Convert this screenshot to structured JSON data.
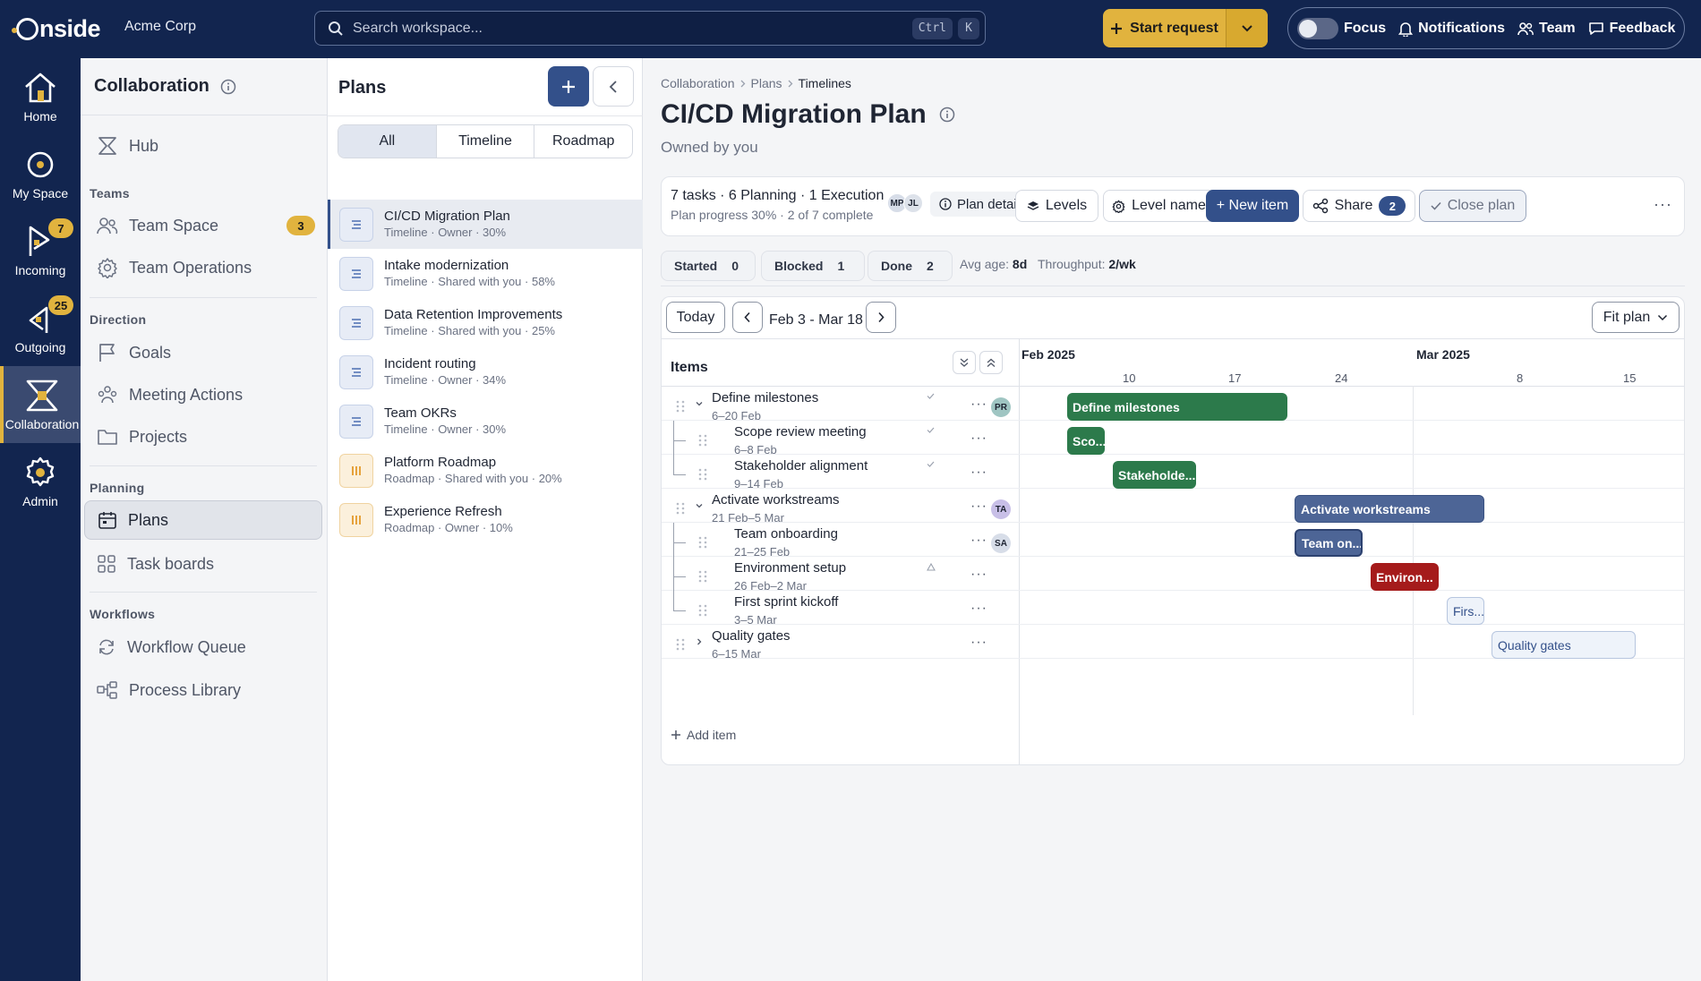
{
  "app": {
    "org_name": "Acme Corp",
    "logo_text": "nside",
    "search_placeholder": "Search workspace...",
    "search_keys": [
      "Ctrl",
      "K"
    ],
    "start_request": "Start request",
    "focus_label": "Focus",
    "focus_on": false,
    "notifications_label": "Notifications",
    "team_label": "Team",
    "feedback_label": "Feedback"
  },
  "rail": [
    {
      "label": "Home",
      "icon": "home-icon"
    },
    {
      "label": "My Space",
      "icon": "target-icon"
    },
    {
      "label": "Incoming",
      "icon": "incoming-flag-icon",
      "badge": "7"
    },
    {
      "label": "Outgoing",
      "icon": "outgoing-flag-icon",
      "badge": "25"
    },
    {
      "label": "Collaboration",
      "icon": "hourglass-icon",
      "active": true
    },
    {
      "label": "Admin",
      "icon": "gear-icon"
    }
  ],
  "nav": {
    "title": "Collaboration",
    "hub": "Hub",
    "sections": {
      "teams": "Teams",
      "direction": "Direction",
      "planning": "Planning",
      "workflows": "Workflows"
    },
    "items": {
      "team_space": "Team Space",
      "team_space_badge": "3",
      "team_operations": "Team Operations",
      "goals": "Goals",
      "meeting_actions": "Meeting Actions",
      "projects": "Projects",
      "plans": "Plans",
      "task_boards": "Task boards",
      "workflow_queue": "Workflow Queue",
      "process_library": "Process Library"
    }
  },
  "plans_panel": {
    "title": "Plans",
    "tabs": [
      "All",
      "Timeline",
      "Roadmap"
    ],
    "active_tab": "All",
    "list": [
      {
        "name": "CI/CD Migration Plan",
        "meta": "Timeline · Owner · 30%",
        "kind": "timeline",
        "selected": true
      },
      {
        "name": "Intake modernization",
        "meta": "Timeline · Shared with you · 58%",
        "kind": "timeline"
      },
      {
        "name": "Data Retention Improvements",
        "meta": "Timeline · Shared with you · 25%",
        "kind": "timeline"
      },
      {
        "name": "Incident routing",
        "meta": "Timeline · Owner · 34%",
        "kind": "timeline"
      },
      {
        "name": "Team OKRs",
        "meta": "Timeline · Owner · 30%",
        "kind": "timeline"
      },
      {
        "name": "Platform Roadmap",
        "meta": "Roadmap · Shared with you · 20%",
        "kind": "roadmap"
      },
      {
        "name": "Experience Refresh",
        "meta": "Roadmap · Owner · 10%",
        "kind": "roadmap"
      }
    ]
  },
  "main": {
    "breadcrumb": [
      "Collaboration",
      "Plans",
      "Timelines"
    ],
    "title": "CI/CD Migration Plan",
    "subtitle": "Owned by you",
    "summary": "7 tasks · 6 Planning · 1 Execution",
    "progress": "Plan progress 30% · 2 of 7 complete",
    "members": [
      "MP",
      "JL"
    ],
    "plan_details": "Plan details",
    "levels": "Levels",
    "level_names": "Level names",
    "new_item": "+ New item",
    "share": "Share",
    "share_count": "2",
    "close_plan": "Close plan",
    "chips": [
      {
        "label": "Started",
        "value": "0"
      },
      {
        "label": "Blocked",
        "value": "1"
      },
      {
        "label": "Done",
        "value": "2"
      }
    ],
    "avg_age_label": "Avg age:",
    "avg_age": "8d",
    "throughput_label": "Throughput:",
    "throughput": "2/wk"
  },
  "gantt": {
    "today": "Today",
    "range": "Feb 3 - Mar 18",
    "fit": "Fit plan",
    "items_header": "Items",
    "months": [
      {
        "label": "Feb 2025",
        "day": 0
      },
      {
        "label": "Mar 2025",
        "day": 26
      }
    ],
    "ticks": [
      {
        "label": "10",
        "day": 7
      },
      {
        "label": "17",
        "day": 14
      },
      {
        "label": "24",
        "day": 21
      },
      {
        "label": "8",
        "day": 33
      },
      {
        "label": "15",
        "day": 40
      }
    ],
    "add_item": "Add item"
  },
  "chart_data": {
    "type": "gantt",
    "x_unit": "date (2025)",
    "range": [
      "2025-02-03",
      "2025-03-18"
    ],
    "tasks": [
      {
        "name": "Define milestones",
        "dates": "6–20 Feb",
        "start": "2025-02-06",
        "end": "2025-02-20",
        "level": 0,
        "expanded": true,
        "assignee": "PR",
        "status": "done",
        "bar_label": "Define milestones",
        "color": "#2c7a4b"
      },
      {
        "name": "Scope review meeting",
        "dates": "6–8 Feb",
        "start": "2025-02-06",
        "end": "2025-02-08",
        "level": 1,
        "status": "done",
        "bar_label": "Sco...",
        "color": "#2c7a4b"
      },
      {
        "name": "Stakeholder alignment",
        "dates": "9–14 Feb",
        "start": "2025-02-09",
        "end": "2025-02-14",
        "level": 1,
        "status": "done",
        "bar_label": "Stakeholde...",
        "color": "#2c7a4b"
      },
      {
        "name": "Activate workstreams",
        "dates": "21 Feb–5 Mar",
        "start": "2025-02-21",
        "end": "2025-03-05",
        "level": 0,
        "expanded": true,
        "assignee": "TA",
        "status": "execution",
        "bar_label": "Activate workstreams",
        "color": "#4d6596"
      },
      {
        "name": "Team onboarding",
        "dates": "21–25 Feb",
        "start": "2025-02-21",
        "end": "2025-02-25",
        "level": 1,
        "assignee": "SA",
        "status": "execution",
        "bar_label": "Team on...",
        "color": "#4d6596"
      },
      {
        "name": "Environment setup",
        "dates": "26 Feb–2 Mar",
        "start": "2025-02-26",
        "end": "2025-03-02",
        "level": 1,
        "status": "blocked",
        "bar_label": "Environ...",
        "color": "#a51b1b"
      },
      {
        "name": "First sprint kickoff",
        "dates": "3–5 Mar",
        "start": "2025-03-03",
        "end": "2025-03-05",
        "level": 1,
        "status": "planning",
        "bar_label": "Firs...",
        "color": "#eef3fa"
      },
      {
        "name": "Quality gates",
        "dates": "6–15 Mar",
        "start": "2025-03-06",
        "end": "2025-03-15",
        "level": 0,
        "expanded": false,
        "status": "planning",
        "bar_label": "Quality gates",
        "color": "#eef3fa"
      }
    ]
  }
}
